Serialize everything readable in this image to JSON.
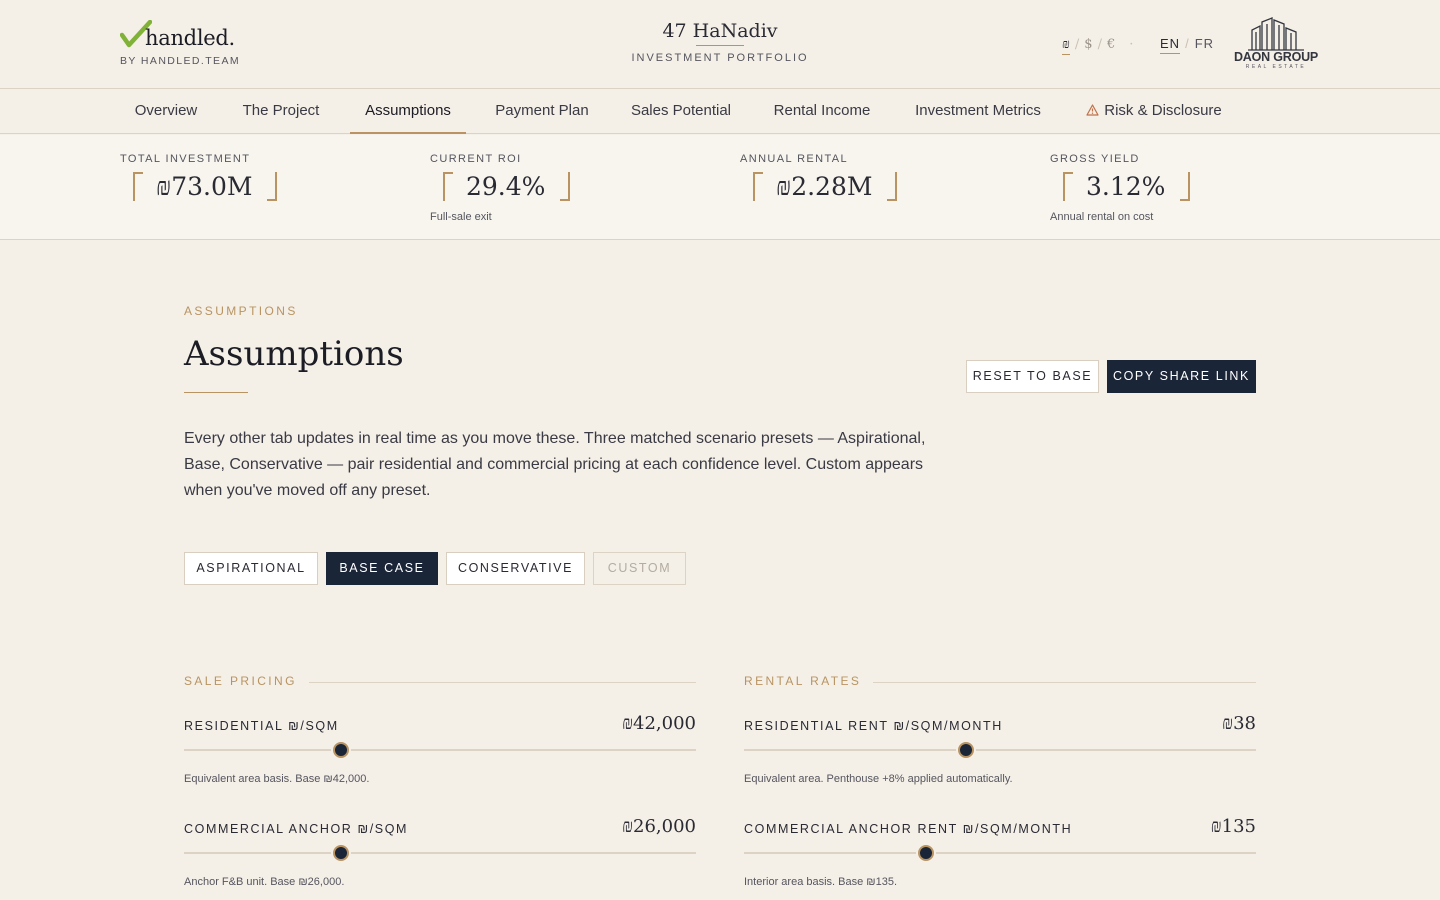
{
  "brand": {
    "wordmark": "handled.",
    "byline": "BY HANDLED.TEAM"
  },
  "project": {
    "title": "47 HaNadiv",
    "subtitle": "INVESTMENT PORTFOLIO"
  },
  "currency": {
    "options": [
      "₪",
      "$",
      "€"
    ],
    "selected": "₪",
    "sep": "/"
  },
  "language": {
    "options": [
      "EN",
      "FR"
    ],
    "selected": "EN",
    "sep": "/"
  },
  "partner": {
    "name": "DAON GROUP",
    "sub": "REAL ESTATE"
  },
  "nav": {
    "tabs": [
      {
        "label": "Overview"
      },
      {
        "label": "The Project"
      },
      {
        "label": "Assumptions",
        "active": true
      },
      {
        "label": "Payment Plan"
      },
      {
        "label": "Sales Potential"
      },
      {
        "label": "Rental Income"
      },
      {
        "label": "Investment Metrics"
      },
      {
        "label": "Risk & Disclosure",
        "icon": "warning-icon"
      }
    ]
  },
  "metrics": [
    {
      "label": "TOTAL INVESTMENT",
      "value": "₪73.0M",
      "note": ""
    },
    {
      "label": "CURRENT ROI",
      "value": "29.4%",
      "note": "Full-sale exit"
    },
    {
      "label": "ANNUAL RENTAL",
      "value": "₪2.28M",
      "note": ""
    },
    {
      "label": "GROSS YIELD",
      "value": "3.12%",
      "note": "Annual rental on cost"
    }
  ],
  "main": {
    "eyebrow": "ASSUMPTIONS",
    "title": "Assumptions",
    "reset_label": "RESET TO BASE",
    "share_label": "COPY SHARE LINK",
    "description": "Every other tab updates in real time as you move these. Three matched scenario presets — Aspirational, Base, Conservative — pair residential and commercial pricing at each confidence level. Custom appears when you've moved off any preset."
  },
  "presets": [
    {
      "label": "ASPIRATIONAL",
      "state": "default"
    },
    {
      "label": "BASE CASE",
      "state": "selected"
    },
    {
      "label": "CONSERVATIVE",
      "state": "default"
    },
    {
      "label": "CUSTOM",
      "state": "disabled"
    }
  ],
  "sale_pricing": {
    "label": "SALE PRICING",
    "fields": [
      {
        "label": "RESIDENTIAL ₪/SQM",
        "value": "₪42,000",
        "position": 0.307,
        "help": "Equivalent area basis. Base ₪42,000."
      },
      {
        "label": "COMMERCIAL ANCHOR ₪/SQM",
        "value": "₪26,000",
        "position": 0.307,
        "help": "Anchor F&B unit. Base ₪26,000."
      }
    ]
  },
  "rental_rates": {
    "label": "RENTAL RATES",
    "fields": [
      {
        "label": "RESIDENTIAL RENT ₪/SQM/MONTH",
        "value": "₪38",
        "position": 0.434,
        "help": "Equivalent area. Penthouse +8% applied automatically."
      },
      {
        "label": "COMMERCIAL ANCHOR RENT ₪/SQM/MONTH",
        "value": "₪135",
        "position": 0.355,
        "help": "Interior area basis. Base ₪135."
      }
    ]
  },
  "colors": {
    "accent": "#b99462",
    "navy": "#1b2538",
    "background": "#f4efe7",
    "check": "#7fb236"
  }
}
